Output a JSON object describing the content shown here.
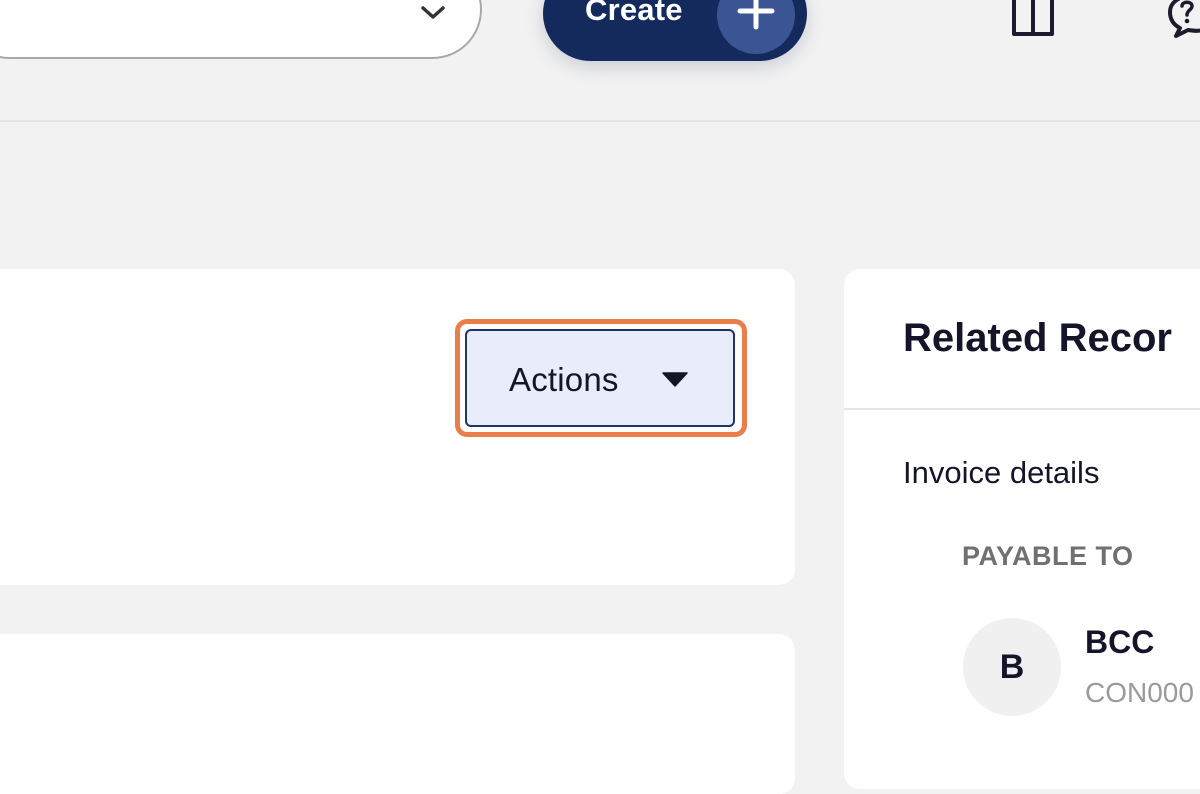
{
  "header": {
    "select_chevron_icon": "chevron-down-icon",
    "create_label": "Create",
    "create_icon": "plus-icon",
    "gift_icon": "gift-icon",
    "help_icon": "help-chat-icon"
  },
  "main": {
    "actions_label": "Actions",
    "actions_icon": "caret-down-icon",
    "highlight_color": "#ea7d4a"
  },
  "related_panel": {
    "title": "Related Recor",
    "section_title": "Invoice details",
    "payable_label": "PAYABLE TO",
    "payee": {
      "avatar_initial": "B",
      "name": "BCC",
      "id": "CON000"
    }
  },
  "colors": {
    "background": "#f2f2f2",
    "create_button": "#142a5c",
    "create_plus_circle": "#3b5594",
    "actions_fill": "#e8ecfb",
    "actions_border": "#1e3366"
  }
}
